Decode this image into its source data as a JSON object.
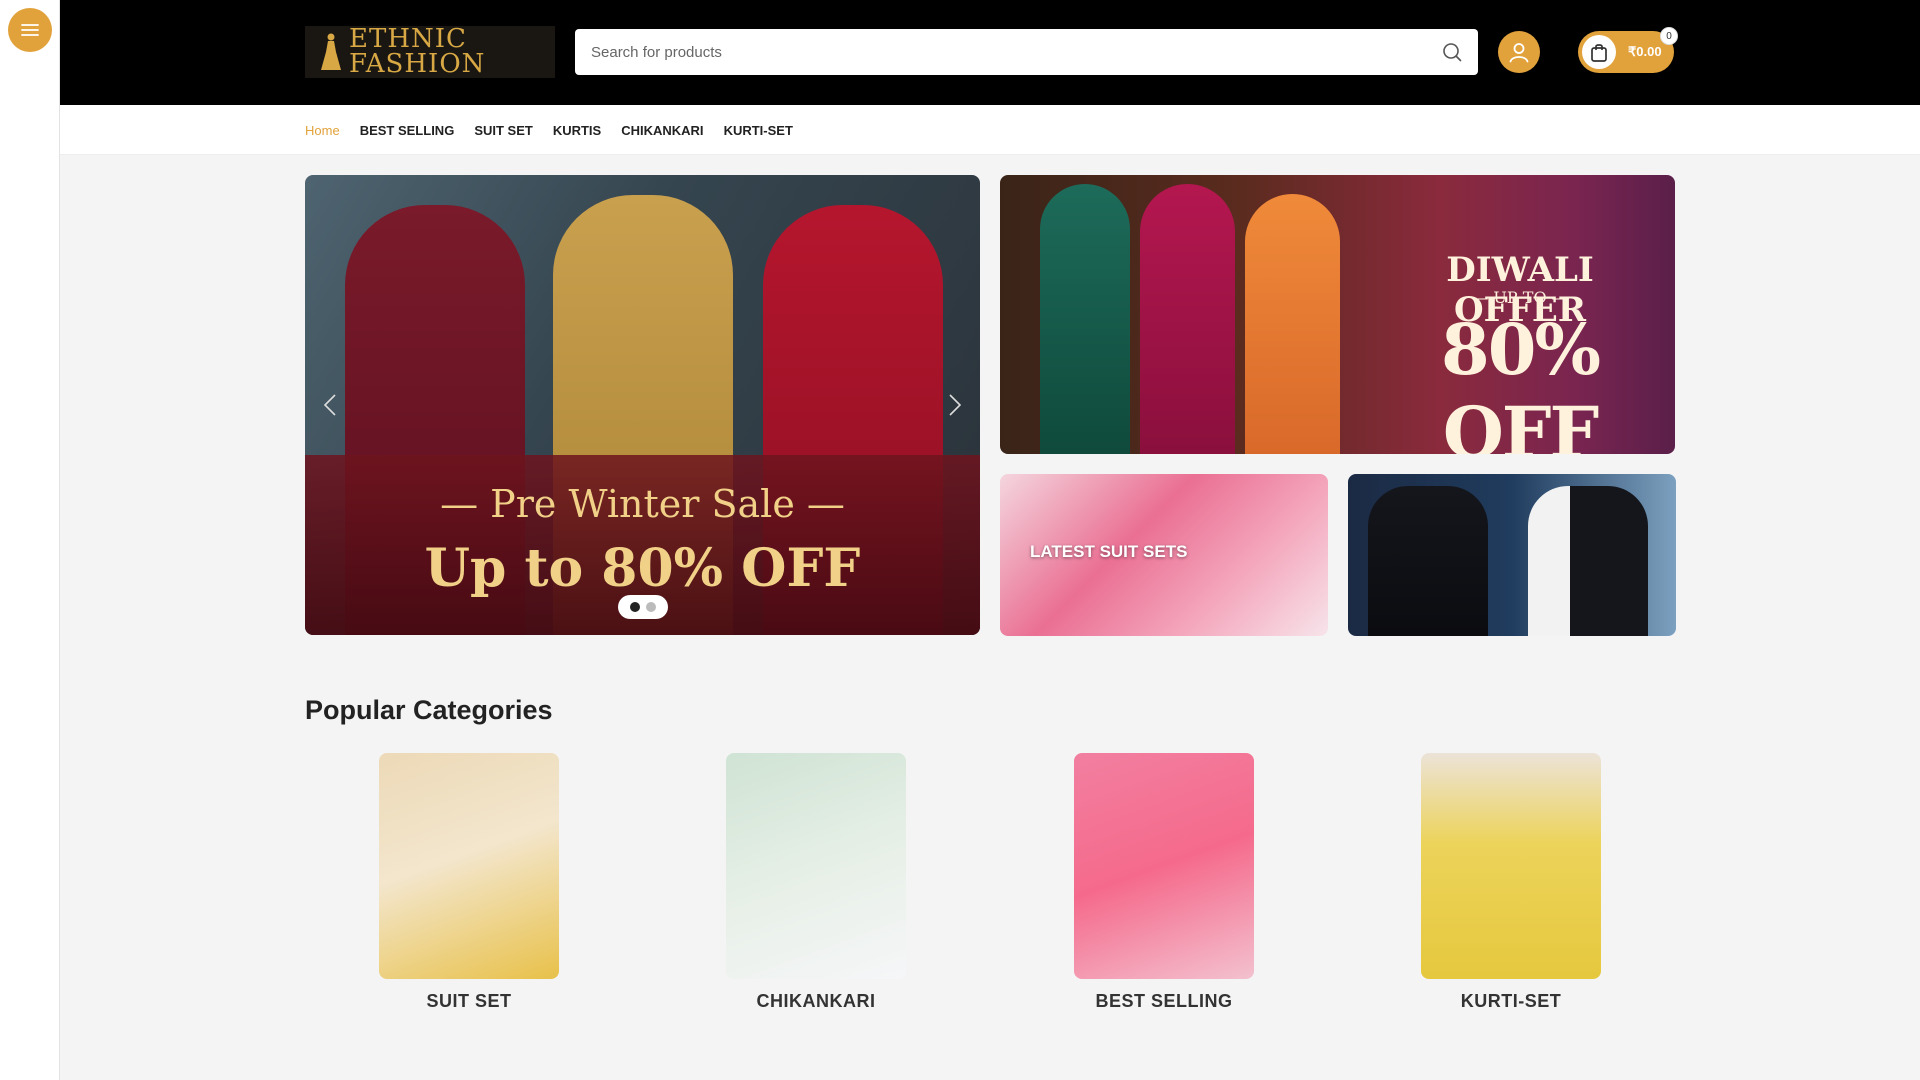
{
  "brand": {
    "name_line1": "ETHNIC",
    "name_line2": "FASHION"
  },
  "search": {
    "placeholder": "Search for products"
  },
  "cart": {
    "total": "₹0.00",
    "count": "0"
  },
  "nav": {
    "items": [
      {
        "label": "Home",
        "active": true
      },
      {
        "label": "BEST SELLING"
      },
      {
        "label": "SUIT SET"
      },
      {
        "label": "KURTIS"
      },
      {
        "label": "CHIKANKARI"
      },
      {
        "label": "KURTI-SET"
      }
    ]
  },
  "hero": {
    "line1": "— Pre Winter Sale —",
    "line2": "Up to 80% OFF",
    "slides": 2,
    "active_slide": 1
  },
  "promo": {
    "line1": "DIWALI OFFER",
    "line2": "— UP TO —",
    "line3": "80% OFF"
  },
  "tiles": {
    "suit_sets": "LATEST SUIT SETS"
  },
  "categories": {
    "title": "Popular Categories",
    "items": [
      {
        "name": "SUIT SET"
      },
      {
        "name": "CHIKANKARI"
      },
      {
        "name": "BEST SELLING"
      },
      {
        "name": "KURTI-SET"
      }
    ]
  },
  "colors": {
    "accent": "#e2a23b",
    "header": "#000000",
    "background": "#f4f4f4"
  },
  "icons": [
    "hamburger-icon",
    "search-icon",
    "user-icon",
    "shopping-bag-icon",
    "chevron-left-icon",
    "chevron-right-icon"
  ]
}
